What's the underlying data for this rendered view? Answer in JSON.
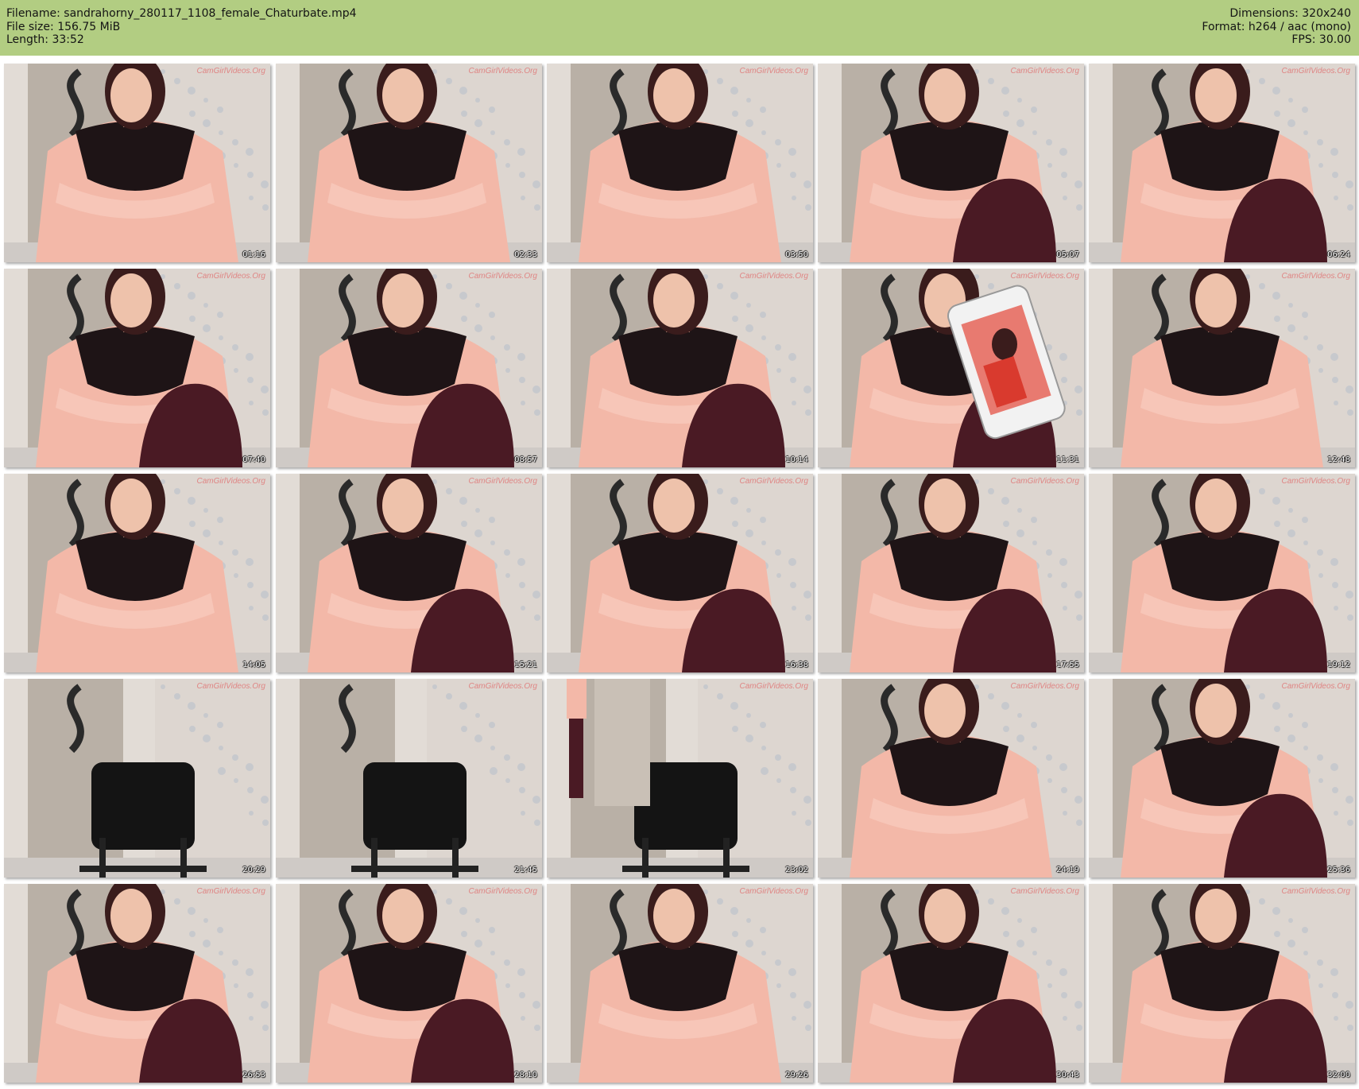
{
  "header": {
    "filename": "Filename: sandrahorny_280117_1108_female_Chaturbate.mp4",
    "filesize": "File size: 156.75 MiB",
    "length": "Length: 33:52",
    "dimensions": "Dimensions: 320x240",
    "format": "Format: h264 / aac (mono)",
    "fps": "FPS: 30.00"
  },
  "colors": {
    "header_bg": "#b2cd82",
    "blouse": "#f3b8a8",
    "lace": "#1e1416",
    "hair": "#3a1c1c",
    "leggings": "#4a1a24",
    "chair": "#141414",
    "wall": "#e2dcd6",
    "door": "#b9b0a6"
  },
  "watermark": "CamGirlVideos.Org",
  "thumbnails": [
    {
      "time": "01:16",
      "scene": "person"
    },
    {
      "time": "02:33",
      "scene": "person"
    },
    {
      "time": "03:50",
      "scene": "person"
    },
    {
      "time": "05:07",
      "scene": "person-knee"
    },
    {
      "time": "06:24",
      "scene": "person-knee"
    },
    {
      "time": "07:40",
      "scene": "person-knee"
    },
    {
      "time": "08:57",
      "scene": "person-knee"
    },
    {
      "time": "10:14",
      "scene": "person-knee"
    },
    {
      "time": "11:31",
      "scene": "phone"
    },
    {
      "time": "12:48",
      "scene": "person"
    },
    {
      "time": "14:05",
      "scene": "person"
    },
    {
      "time": "15:21",
      "scene": "person-knee"
    },
    {
      "time": "16:38",
      "scene": "person-knee"
    },
    {
      "time": "17:55",
      "scene": "person-knee"
    },
    {
      "time": "19:12",
      "scene": "person-knee"
    },
    {
      "time": "20:29",
      "scene": "empty-chair"
    },
    {
      "time": "21:45",
      "scene": "empty-chair"
    },
    {
      "time": "23:02",
      "scene": "chair-door"
    },
    {
      "time": "24:19",
      "scene": "person"
    },
    {
      "time": "25:36",
      "scene": "person-knee"
    },
    {
      "time": "26:53",
      "scene": "person-knee"
    },
    {
      "time": "28:10",
      "scene": "person-knee"
    },
    {
      "time": "29:26",
      "scene": "person"
    },
    {
      "time": "30:43",
      "scene": "person-knee"
    },
    {
      "time": "32:00",
      "scene": "person-knee"
    }
  ]
}
